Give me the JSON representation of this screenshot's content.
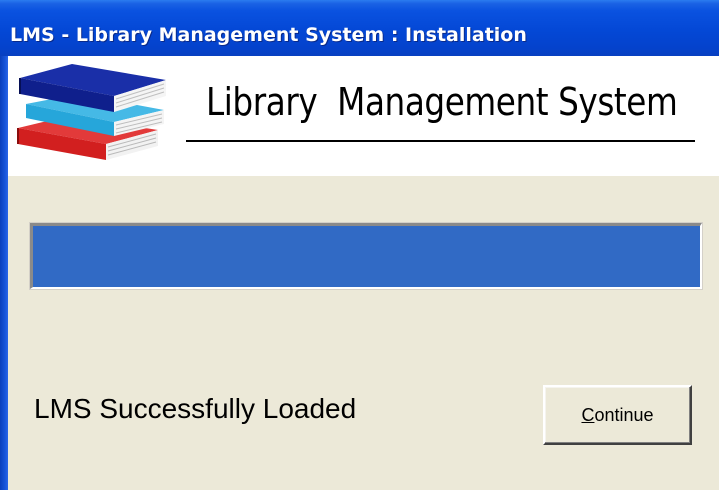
{
  "window": {
    "title": "LMS - Library Management System : Installation"
  },
  "banner": {
    "title": "Library  Management System",
    "logo_icon": "books-stack-icon"
  },
  "progress": {
    "value_percent": 100,
    "fill_color": "#316ac5"
  },
  "status": {
    "text": "LMS Successfully Loaded"
  },
  "continue_button": {
    "accel": "C",
    "rest": "ontinue"
  },
  "colors": {
    "title_bar": "#0448d6",
    "dialog_background": "#ece9d8",
    "banner_background": "#ffffff"
  }
}
